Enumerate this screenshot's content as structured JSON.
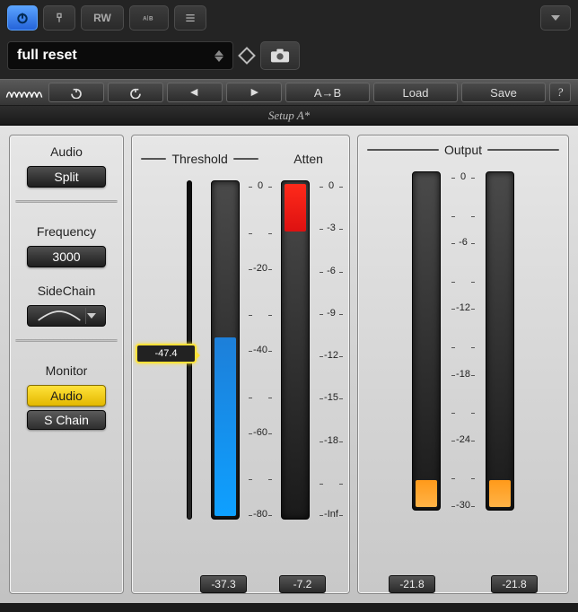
{
  "toolbar_icons": {
    "power": "power",
    "bypass": "bypass",
    "rw": "RW",
    "ab_compare": "AB",
    "list": "list",
    "dropdown": "dropdown"
  },
  "preset": {
    "name": "full reset"
  },
  "waves_toolbar": {
    "undo": "undo",
    "redo": "redo",
    "prev": "prev",
    "next": "next",
    "ab": "A→B",
    "load": "Load",
    "save": "Save",
    "help": "?"
  },
  "setup_label": "Setup A*",
  "left": {
    "audio_label": "Audio",
    "audio_mode": "Split",
    "freq_label": "Frequency",
    "freq_value": "3000",
    "sidechain_label": "SideChain",
    "monitor_label": "Monitor",
    "monitor_audio": "Audio",
    "monitor_schain": "S Chain"
  },
  "threshold": {
    "label": "Threshold",
    "slider_value": "-47.4",
    "slider_pos_pct": 51,
    "scale": [
      "0",
      "",
      "-20",
      "",
      "-40",
      "",
      "-60",
      "",
      "-80"
    ],
    "meter_fill_pct": 53,
    "readout": "-37.3"
  },
  "atten": {
    "label": "Atten",
    "scale": [
      "0",
      "-3",
      "-6",
      "-9",
      "-12",
      "-15",
      "-18",
      "",
      "-Inf"
    ],
    "red_bar_pct": 14,
    "readout": "-7.2"
  },
  "output": {
    "label": "Output",
    "scale": [
      "0",
      "",
      "-6",
      "",
      "-12",
      "",
      "-18",
      "",
      "-24",
      "",
      "-30"
    ],
    "left_fill_pct": 8,
    "right_fill_pct": 8,
    "left_readout": "-21.8",
    "right_readout": "-21.8"
  }
}
